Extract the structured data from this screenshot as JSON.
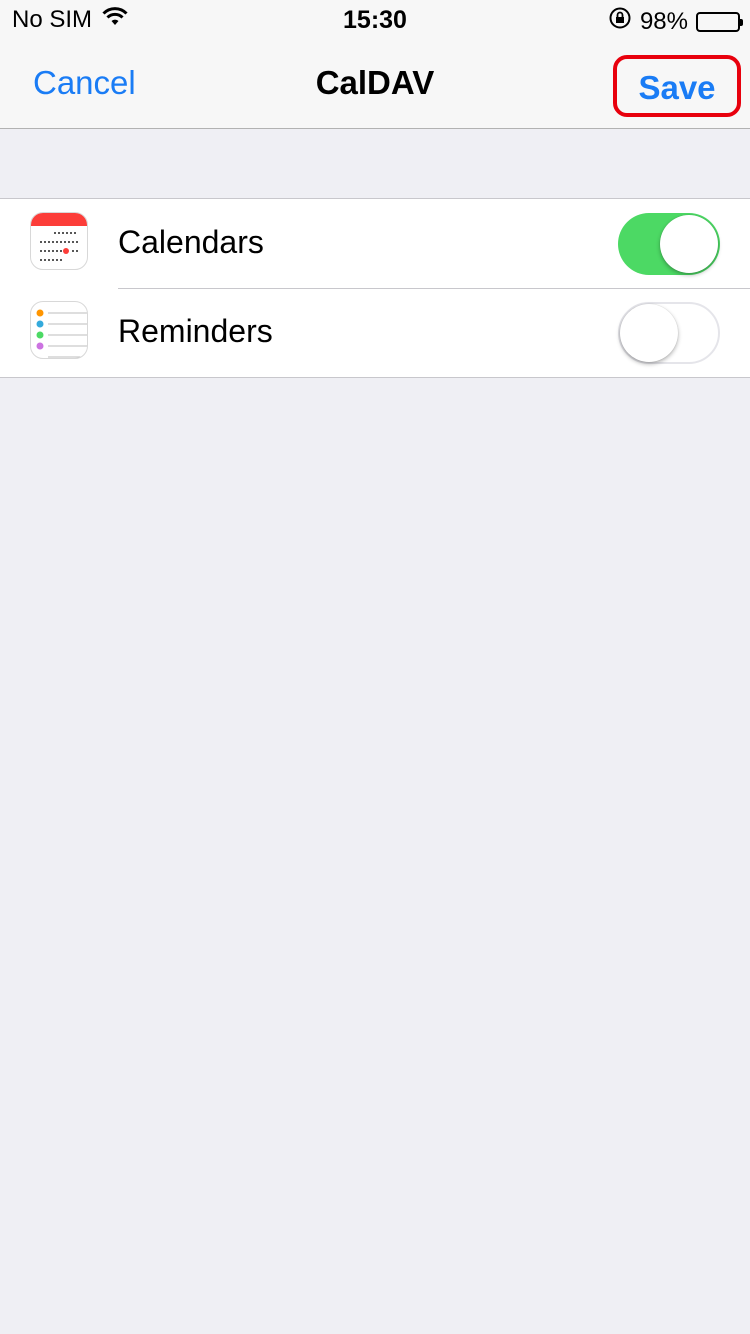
{
  "status_bar": {
    "carrier": "No SIM",
    "time": "15:30",
    "battery_percent": "98%",
    "battery_level": 0.98,
    "icons": [
      "wifi-icon",
      "rotation-lock-icon",
      "battery-icon"
    ]
  },
  "navbar": {
    "cancel_label": "Cancel",
    "title": "CalDAV",
    "save_label": "Save"
  },
  "rows": [
    {
      "label": "Calendars",
      "icon": "calendar-app-icon",
      "enabled": true
    },
    {
      "label": "Reminders",
      "icon": "reminders-app-icon",
      "enabled": false
    }
  ],
  "colors": {
    "accent": "#1a7cf5",
    "toggle_on": "#4cd964",
    "highlight": "#e8000d"
  }
}
